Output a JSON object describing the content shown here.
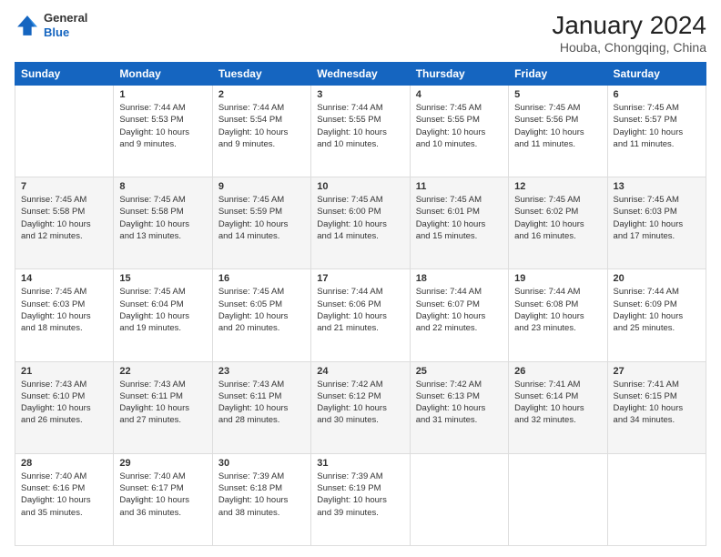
{
  "header": {
    "logo_line1": "General",
    "logo_line2": "Blue",
    "month": "January 2024",
    "location": "Houba, Chongqing, China"
  },
  "weekdays": [
    "Sunday",
    "Monday",
    "Tuesday",
    "Wednesday",
    "Thursday",
    "Friday",
    "Saturday"
  ],
  "weeks": [
    [
      {
        "day": "",
        "info": ""
      },
      {
        "day": "1",
        "info": "Sunrise: 7:44 AM\nSunset: 5:53 PM\nDaylight: 10 hours\nand 9 minutes."
      },
      {
        "day": "2",
        "info": "Sunrise: 7:44 AM\nSunset: 5:54 PM\nDaylight: 10 hours\nand 9 minutes."
      },
      {
        "day": "3",
        "info": "Sunrise: 7:44 AM\nSunset: 5:55 PM\nDaylight: 10 hours\nand 10 minutes."
      },
      {
        "day": "4",
        "info": "Sunrise: 7:45 AM\nSunset: 5:55 PM\nDaylight: 10 hours\nand 10 minutes."
      },
      {
        "day": "5",
        "info": "Sunrise: 7:45 AM\nSunset: 5:56 PM\nDaylight: 10 hours\nand 11 minutes."
      },
      {
        "day": "6",
        "info": "Sunrise: 7:45 AM\nSunset: 5:57 PM\nDaylight: 10 hours\nand 11 minutes."
      }
    ],
    [
      {
        "day": "7",
        "info": "Sunrise: 7:45 AM\nSunset: 5:58 PM\nDaylight: 10 hours\nand 12 minutes."
      },
      {
        "day": "8",
        "info": "Sunrise: 7:45 AM\nSunset: 5:58 PM\nDaylight: 10 hours\nand 13 minutes."
      },
      {
        "day": "9",
        "info": "Sunrise: 7:45 AM\nSunset: 5:59 PM\nDaylight: 10 hours\nand 14 minutes."
      },
      {
        "day": "10",
        "info": "Sunrise: 7:45 AM\nSunset: 6:00 PM\nDaylight: 10 hours\nand 14 minutes."
      },
      {
        "day": "11",
        "info": "Sunrise: 7:45 AM\nSunset: 6:01 PM\nDaylight: 10 hours\nand 15 minutes."
      },
      {
        "day": "12",
        "info": "Sunrise: 7:45 AM\nSunset: 6:02 PM\nDaylight: 10 hours\nand 16 minutes."
      },
      {
        "day": "13",
        "info": "Sunrise: 7:45 AM\nSunset: 6:03 PM\nDaylight: 10 hours\nand 17 minutes."
      }
    ],
    [
      {
        "day": "14",
        "info": "Sunrise: 7:45 AM\nSunset: 6:03 PM\nDaylight: 10 hours\nand 18 minutes."
      },
      {
        "day": "15",
        "info": "Sunrise: 7:45 AM\nSunset: 6:04 PM\nDaylight: 10 hours\nand 19 minutes."
      },
      {
        "day": "16",
        "info": "Sunrise: 7:45 AM\nSunset: 6:05 PM\nDaylight: 10 hours\nand 20 minutes."
      },
      {
        "day": "17",
        "info": "Sunrise: 7:44 AM\nSunset: 6:06 PM\nDaylight: 10 hours\nand 21 minutes."
      },
      {
        "day": "18",
        "info": "Sunrise: 7:44 AM\nSunset: 6:07 PM\nDaylight: 10 hours\nand 22 minutes."
      },
      {
        "day": "19",
        "info": "Sunrise: 7:44 AM\nSunset: 6:08 PM\nDaylight: 10 hours\nand 23 minutes."
      },
      {
        "day": "20",
        "info": "Sunrise: 7:44 AM\nSunset: 6:09 PM\nDaylight: 10 hours\nand 25 minutes."
      }
    ],
    [
      {
        "day": "21",
        "info": "Sunrise: 7:43 AM\nSunset: 6:10 PM\nDaylight: 10 hours\nand 26 minutes."
      },
      {
        "day": "22",
        "info": "Sunrise: 7:43 AM\nSunset: 6:11 PM\nDaylight: 10 hours\nand 27 minutes."
      },
      {
        "day": "23",
        "info": "Sunrise: 7:43 AM\nSunset: 6:11 PM\nDaylight: 10 hours\nand 28 minutes."
      },
      {
        "day": "24",
        "info": "Sunrise: 7:42 AM\nSunset: 6:12 PM\nDaylight: 10 hours\nand 30 minutes."
      },
      {
        "day": "25",
        "info": "Sunrise: 7:42 AM\nSunset: 6:13 PM\nDaylight: 10 hours\nand 31 minutes."
      },
      {
        "day": "26",
        "info": "Sunrise: 7:41 AM\nSunset: 6:14 PM\nDaylight: 10 hours\nand 32 minutes."
      },
      {
        "day": "27",
        "info": "Sunrise: 7:41 AM\nSunset: 6:15 PM\nDaylight: 10 hours\nand 34 minutes."
      }
    ],
    [
      {
        "day": "28",
        "info": "Sunrise: 7:40 AM\nSunset: 6:16 PM\nDaylight: 10 hours\nand 35 minutes."
      },
      {
        "day": "29",
        "info": "Sunrise: 7:40 AM\nSunset: 6:17 PM\nDaylight: 10 hours\nand 36 minutes."
      },
      {
        "day": "30",
        "info": "Sunrise: 7:39 AM\nSunset: 6:18 PM\nDaylight: 10 hours\nand 38 minutes."
      },
      {
        "day": "31",
        "info": "Sunrise: 7:39 AM\nSunset: 6:19 PM\nDaylight: 10 hours\nand 39 minutes."
      },
      {
        "day": "",
        "info": ""
      },
      {
        "day": "",
        "info": ""
      },
      {
        "day": "",
        "info": ""
      }
    ]
  ]
}
